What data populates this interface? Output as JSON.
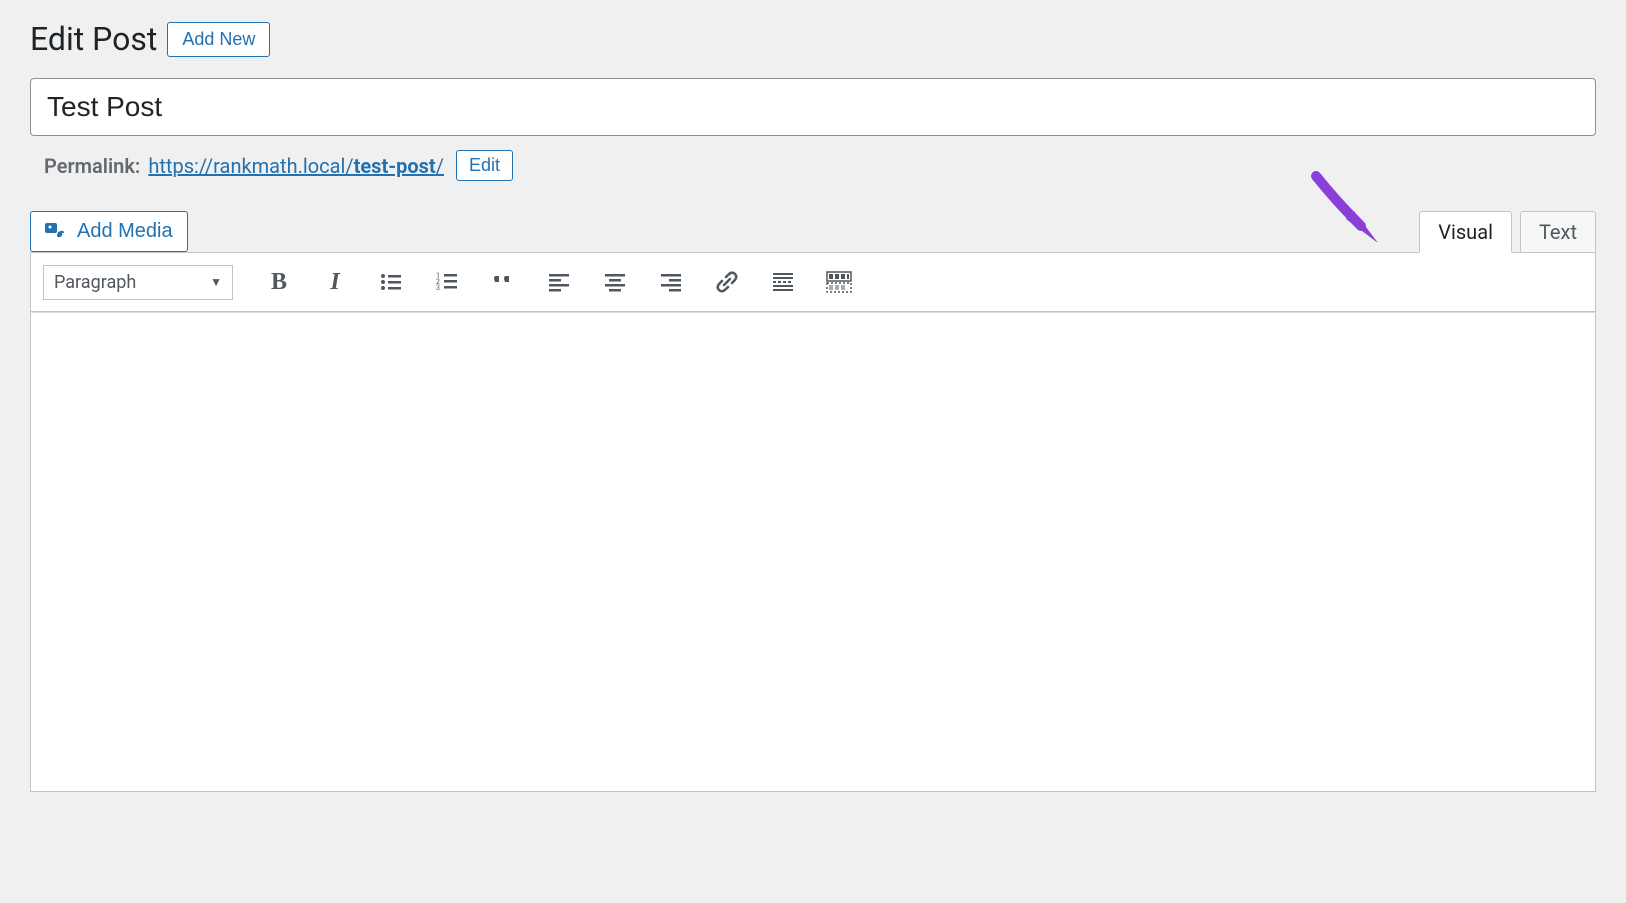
{
  "header": {
    "title": "Edit Post",
    "add_new": "Add New"
  },
  "post": {
    "title": "Test Post"
  },
  "permalink": {
    "label": "Permalink:",
    "url_prefix": "https://rankmath.local/",
    "slug": "test-post",
    "url_suffix": "/",
    "edit_label": "Edit"
  },
  "media": {
    "add_media": "Add Media"
  },
  "tabs": {
    "visual": "Visual",
    "text": "Text"
  },
  "toolbar": {
    "format_selected": "Paragraph"
  }
}
